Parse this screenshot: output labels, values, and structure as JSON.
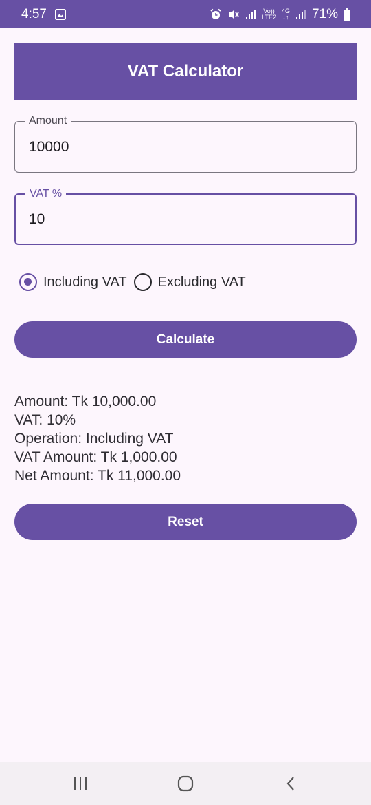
{
  "status_bar": {
    "time": "4:57",
    "network_vo": "Vo))",
    "network_lte": "LTE2",
    "network_4g": "4G",
    "network_arrows": "↓↑",
    "battery": "71%"
  },
  "app": {
    "title": "VAT Calculator"
  },
  "amount_field": {
    "label": "Amount",
    "value": "10000"
  },
  "vat_field": {
    "label": "VAT %",
    "value": "10"
  },
  "operation": {
    "options": [
      "Including VAT",
      "Excluding VAT"
    ],
    "selected": "Including VAT"
  },
  "buttons": {
    "calculate": "Calculate",
    "reset": "Reset"
  },
  "results": {
    "amount": "Amount: Tk 10,000.00",
    "vat": "VAT: 10%",
    "operation": "Operation: Including VAT",
    "vat_amount": "VAT Amount: Tk 1,000.00",
    "net_amount": "Net Amount: Tk 11,000.00"
  },
  "colors": {
    "primary": "#6750a4",
    "background": "#fdf6fd",
    "text": "#2a2a2e"
  },
  "icons": {
    "status": [
      "image-icon",
      "alarm-icon",
      "mute-icon",
      "signal-icon",
      "battery-icon"
    ],
    "nav": [
      "recent-apps-icon",
      "home-icon",
      "back-icon"
    ]
  }
}
